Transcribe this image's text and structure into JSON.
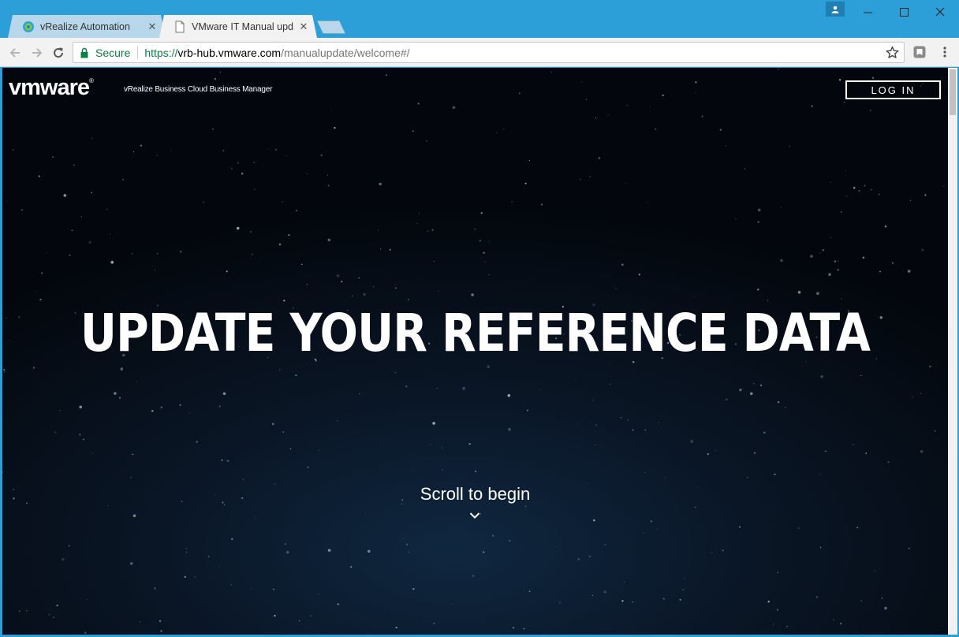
{
  "browser": {
    "tabs": [
      {
        "label": "vRealize Automation",
        "active": false,
        "favicon": "globe-icon"
      },
      {
        "label": "VMware IT Manual update",
        "active": true,
        "favicon": "page-icon"
      }
    ],
    "address": {
      "secure_label": "Secure",
      "url_scheme": "https://",
      "url_host": "vrb-hub.vmware.com",
      "url_path": "/manualupdate/welcome#/"
    },
    "accent_color": "#2d9fd8"
  },
  "page": {
    "logo": "vmware",
    "logo_mark": "®",
    "subtitle": "vRealize Business Cloud Business Manager",
    "login_label": "LOG IN",
    "headline": "UPDATE YOUR REFERENCE DATA",
    "scroll_label": "Scroll to begin"
  }
}
